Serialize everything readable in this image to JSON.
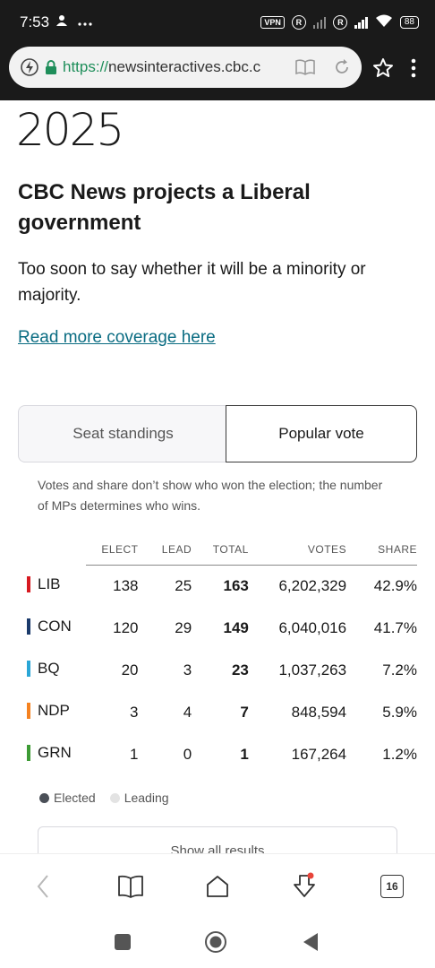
{
  "status_bar": {
    "time": "7:53",
    "vpn_label": "VPN",
    "roaming_label": "R",
    "battery": "88"
  },
  "browser": {
    "url_scheme": "https://",
    "url_host": "newsinteractives.cbc.c"
  },
  "article": {
    "year": "2025",
    "headline": "CBC News projects a Liberal government",
    "subtext": "Too soon to say whether it will be a minority or majority.",
    "read_more": "Read more coverage here"
  },
  "toggle": {
    "seat_standings": "Seat standings",
    "popular_vote": "Popular vote",
    "active": "popular_vote"
  },
  "note": "Votes and share don’t show who won the election; the number of MPs determines who wins.",
  "table": {
    "headers": {
      "elect": "ELECT",
      "lead": "LEAD",
      "total": "TOTAL",
      "votes": "VOTES",
      "share": "SHARE"
    },
    "rows": [
      {
        "party": "LIB",
        "color": "#d71920",
        "elect": "138",
        "lead": "25",
        "total": "163",
        "votes": "6,202,329",
        "share": "42.9%"
      },
      {
        "party": "CON",
        "color": "#1a3a6b",
        "elect": "120",
        "lead": "29",
        "total": "149",
        "votes": "6,040,016",
        "share": "41.7%"
      },
      {
        "party": "BQ",
        "color": "#2aa6d6",
        "elect": "20",
        "lead": "3",
        "total": "23",
        "votes": "1,037,263",
        "share": "7.2%"
      },
      {
        "party": "NDP",
        "color": "#f58220",
        "elect": "3",
        "lead": "4",
        "total": "7",
        "votes": "848,594",
        "share": "5.9%"
      },
      {
        "party": "GRN",
        "color": "#3d9b35",
        "elect": "1",
        "lead": "0",
        "total": "1",
        "votes": "167,264",
        "share": "1.2%"
      }
    ]
  },
  "legend": {
    "elected": "Elected",
    "elected_color": "#4a4f57",
    "leading": "Leading",
    "leading_color": "#e3e3e3"
  },
  "show_all": "Show all results",
  "toolbar": {
    "tab_count": "16"
  },
  "colors": {
    "link": "#0a6c82",
    "status_bar_bg": "#1a1a1a"
  }
}
